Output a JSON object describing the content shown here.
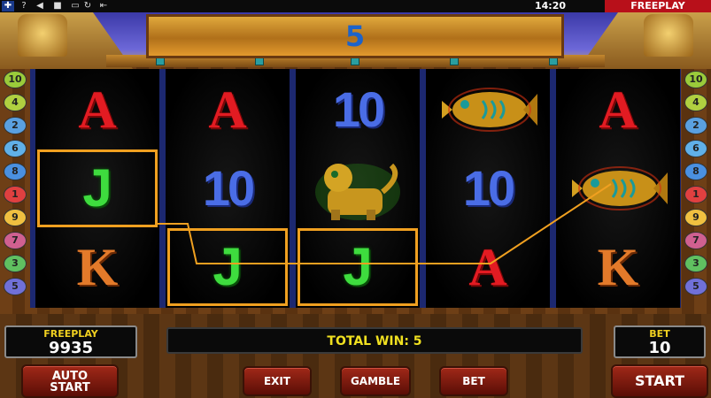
{
  "top_bar": {
    "flag_icon": "uk-flag-icon",
    "icons": [
      "help-icon",
      "sound-icon",
      "play-icon",
      "fullscreen-icon",
      "reload-icon",
      "exit-icon"
    ],
    "time": "14:20",
    "mode_tab": "FREEPLAY"
  },
  "win_banner": {
    "value": "5"
  },
  "paytable_left": [
    "10",
    "4",
    "2",
    "6",
    "8",
    "1",
    "9",
    "7",
    "3",
    "5"
  ],
  "paytable_right": [
    "10",
    "4",
    "2",
    "6",
    "8",
    "1",
    "9",
    "7",
    "3",
    "5"
  ],
  "reels": [
    [
      "A",
      "J",
      "K"
    ],
    [
      "A",
      "10",
      "J"
    ],
    [
      "10",
      "jaguar",
      "J"
    ],
    [
      "fish",
      "10",
      "A"
    ],
    [
      "A",
      "fish",
      "K"
    ]
  ],
  "winning_cells": [
    [
      0,
      1
    ],
    [
      1,
      2
    ],
    [
      2,
      2
    ]
  ],
  "colors": {
    "win_box": "#f0a020",
    "jackpot_symbol": "#3edc3e",
    "accent_red": "#b8101a",
    "banner_digit": "#1d63c9"
  },
  "panel": {
    "freeplay_label": "FREEPLAY",
    "freeplay_value": "9935",
    "message": "TOTAL WIN: 5",
    "bet_label": "BET",
    "bet_value": "10"
  },
  "buttons": {
    "auto_start_line1": "AUTO",
    "auto_start_line2": "START",
    "exit": "EXIT",
    "gamble": "GAMBLE",
    "bet": "BET",
    "start": "START"
  }
}
